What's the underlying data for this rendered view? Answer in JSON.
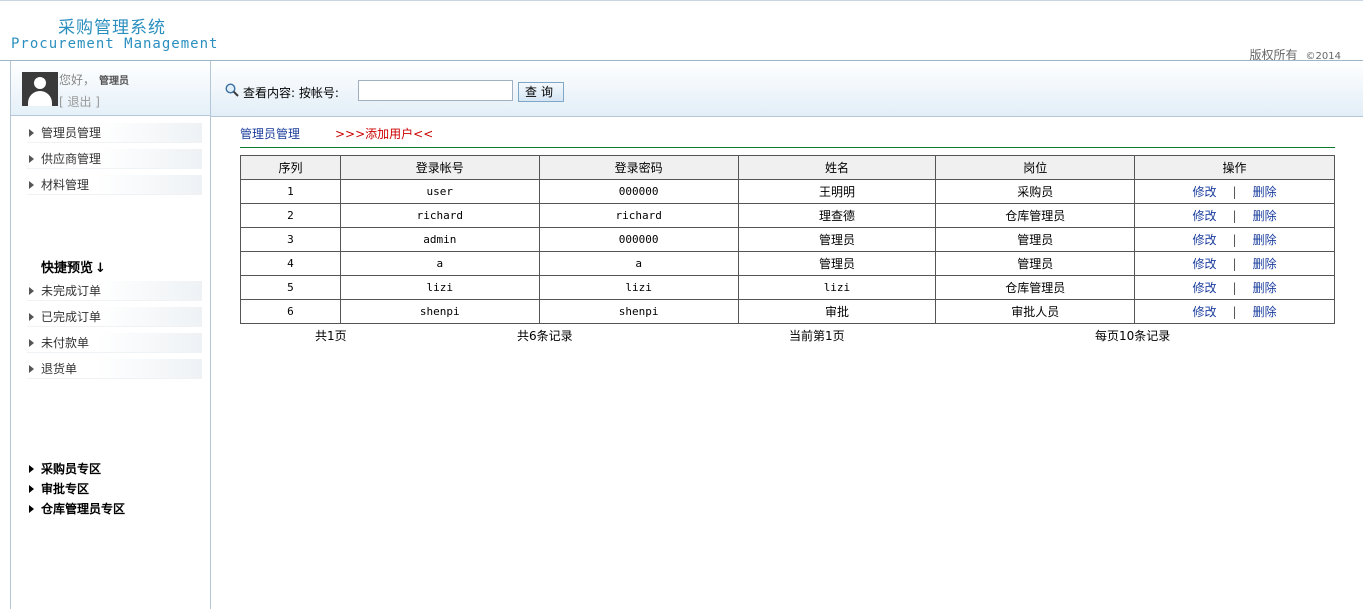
{
  "header": {
    "title_cn": "采购管理系统",
    "title_en": "Procurement Management",
    "copyright": "版权所有",
    "year": "©2014"
  },
  "user": {
    "greeting": "您好，",
    "name": "管理员",
    "logout": "[ 退出 ]"
  },
  "sidebar": {
    "menu": [
      "管理员管理",
      "供应商管理",
      "材料管理"
    ],
    "quick_title": "快捷预览",
    "quick_arrow": "↓",
    "quick_items": [
      "未完成订单",
      "已完成订单",
      "未付款单",
      "退货单"
    ],
    "zones": [
      "采购员专区",
      "审批专区",
      "仓库管理员专区"
    ]
  },
  "search": {
    "label": "查看内容:  按帐号:",
    "value": "",
    "button": "查询"
  },
  "content": {
    "crumb": "管理员管理",
    "add_link": ">>>添加用户<<",
    "columns": [
      "序列",
      "登录帐号",
      "登录密码",
      "姓名",
      "岗位",
      "操作"
    ],
    "rows": [
      {
        "no": "1",
        "account": "user",
        "password": "000000",
        "name": "王明明",
        "post": "采购员"
      },
      {
        "no": "2",
        "account": "richard",
        "password": "richard",
        "name": "理查德",
        "post": "仓库管理员"
      },
      {
        "no": "3",
        "account": "admin",
        "password": "000000",
        "name": "管理员",
        "post": "管理员"
      },
      {
        "no": "4",
        "account": "a",
        "password": "a",
        "name": "管理员",
        "post": "管理员"
      },
      {
        "no": "5",
        "account": "lizi",
        "password": "lizi",
        "name": "lizi",
        "post": "仓库管理员"
      },
      {
        "no": "6",
        "account": "shenpi",
        "password": "shenpi",
        "name": "审批",
        "post": "审批人员"
      }
    ],
    "edit_label": "修改",
    "separator": "|",
    "delete_label": "删除",
    "pager": {
      "total_pages": "共1页",
      "total_records": "共6条记录",
      "current_page": "当前第1页",
      "per_page": "每页10条记录"
    }
  }
}
